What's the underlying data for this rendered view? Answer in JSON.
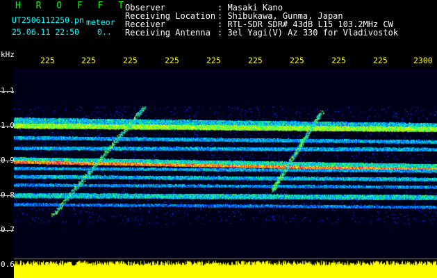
{
  "header": {
    "logo": "H R O F F T",
    "file_name": "UT2506112250.pn",
    "file_suffix": "meteor",
    "datetime": "25.06.11 22:50",
    "extra": "0..",
    "fields": [
      {
        "label": "Observer",
        "value": ": Masaki Kano"
      },
      {
        "label": "Receiving Location",
        "value": ": Shibukawa, Gunma, Japan"
      },
      {
        "label": "Receiver",
        "value": ": RTL-SDR SDR# 43dB L15 103.2MHz CW"
      },
      {
        "label": "Receiving Antenna",
        "value": ": 3el Yagi(V) Az 330 for Vladivostok"
      }
    ]
  },
  "axes": {
    "y_unit": "kHz",
    "y_ticks": [
      "1.1",
      "1.0",
      "0.9",
      "0.8",
      "0.7",
      "0.6"
    ],
    "x_ticks": [
      "225",
      "225",
      "225",
      "225",
      "225",
      "225",
      "225",
      "225",
      "225",
      "2300"
    ]
  },
  "colors": {
    "background": "#000000",
    "header_text": "#ffffff",
    "logo": "#00ff00",
    "file_text": "#00ffff",
    "x_ticks": "#ffff00",
    "level_bars": "#ffff00"
  }
}
